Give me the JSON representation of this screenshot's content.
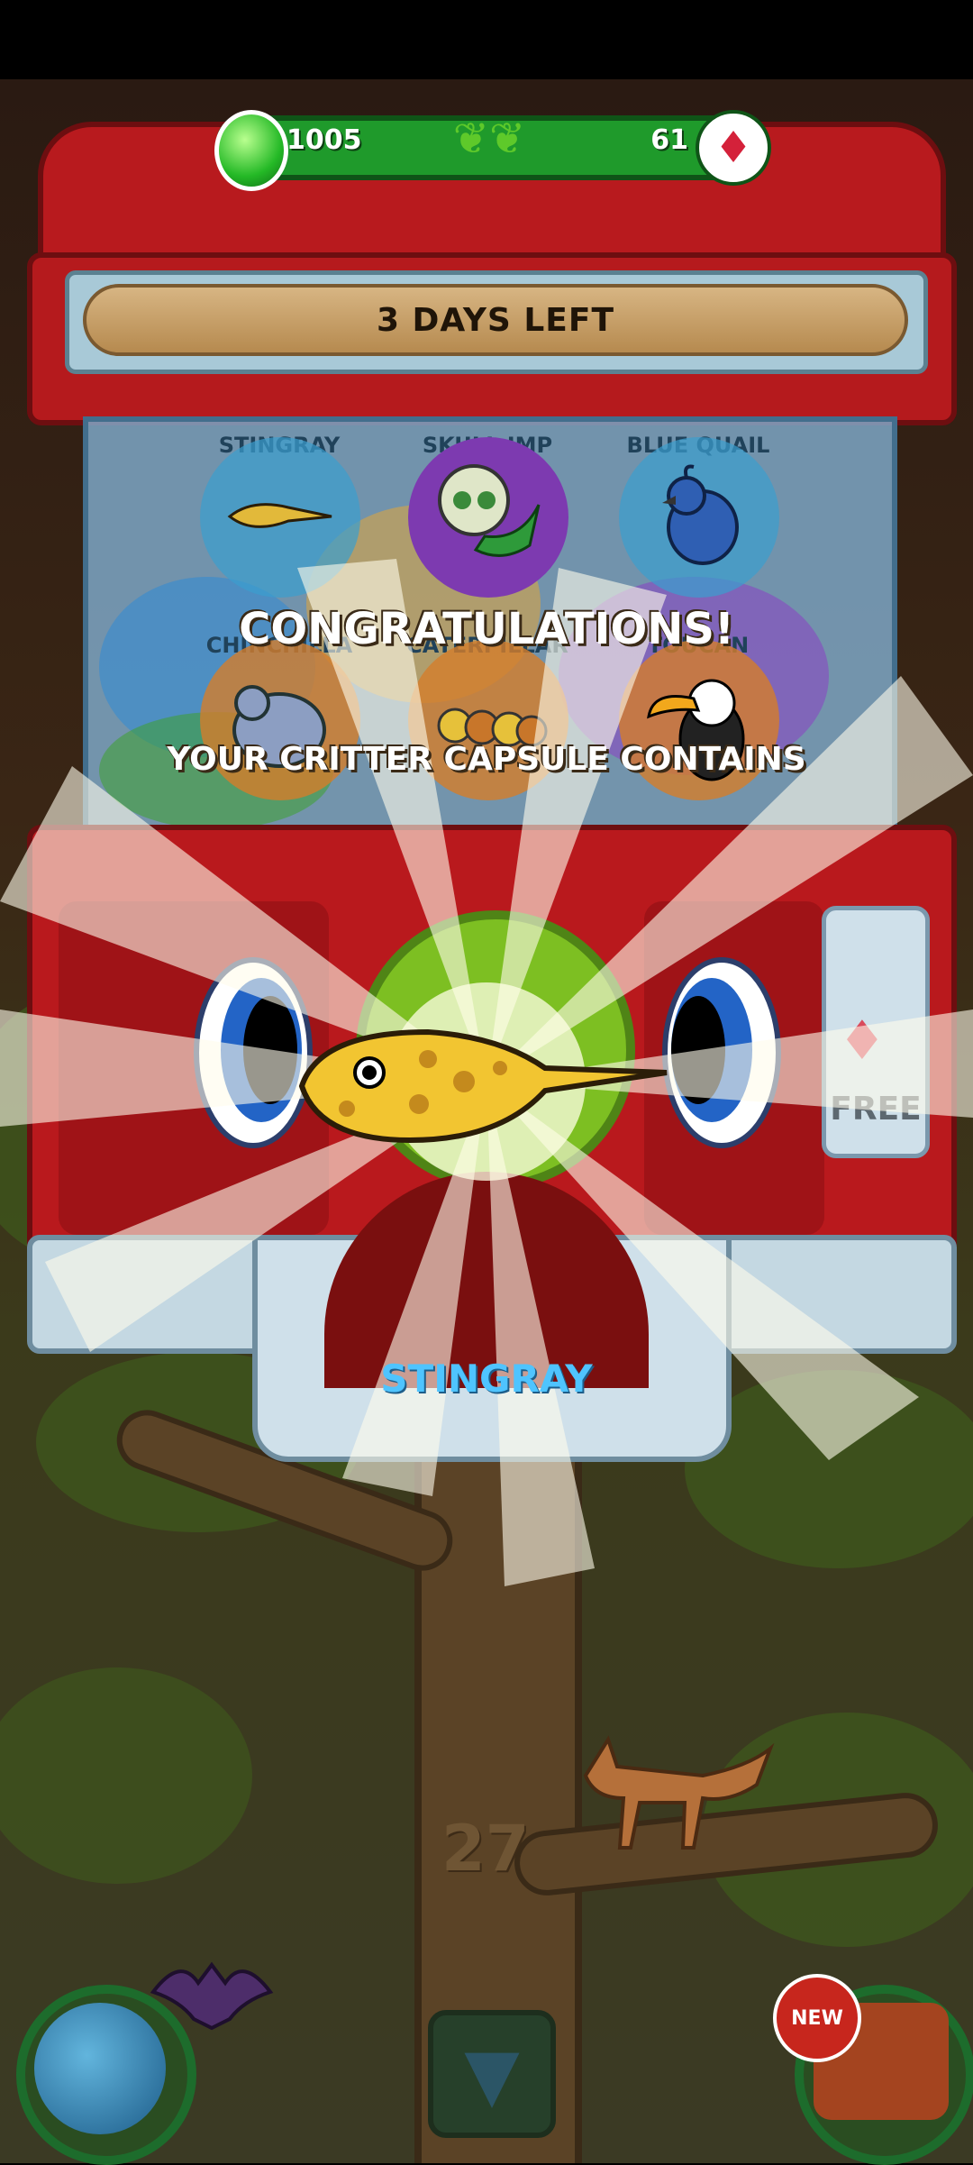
{
  "currency": {
    "green_gems": "1005",
    "red_gems": "61"
  },
  "banner": {
    "text": "3 DAYS LEFT"
  },
  "capsule_grid": {
    "items": [
      {
        "label": "STINGRAY",
        "color": "#3a9ecf"
      },
      {
        "label": "SKULL IMP",
        "color": "#7d3ab0"
      },
      {
        "label": "BLUE QUAIL",
        "color": "#3a9ecf"
      },
      {
        "label": "CHINCHILLA",
        "color": "#d47d2a"
      },
      {
        "label": "CATERPILLAR",
        "color": "#d47d2a"
      },
      {
        "label": "TOUCAN",
        "color": "#d47d2a"
      }
    ]
  },
  "reveal": {
    "title": "CONGRATULATIONS!",
    "subtitle": "YOUR CRITTER CAPSULE CONTAINS",
    "critter_name": "STINGRAY"
  },
  "free_button": {
    "label": "FREE"
  },
  "tree": {
    "level": "27"
  },
  "bottom_nav": {
    "new_badge": "NEW"
  },
  "icons": [
    "green-gem-icon",
    "leaf-ornament-icon",
    "red-crystal-icon",
    "globe-icon",
    "down-arrow-icon",
    "treehouse-icon"
  ]
}
